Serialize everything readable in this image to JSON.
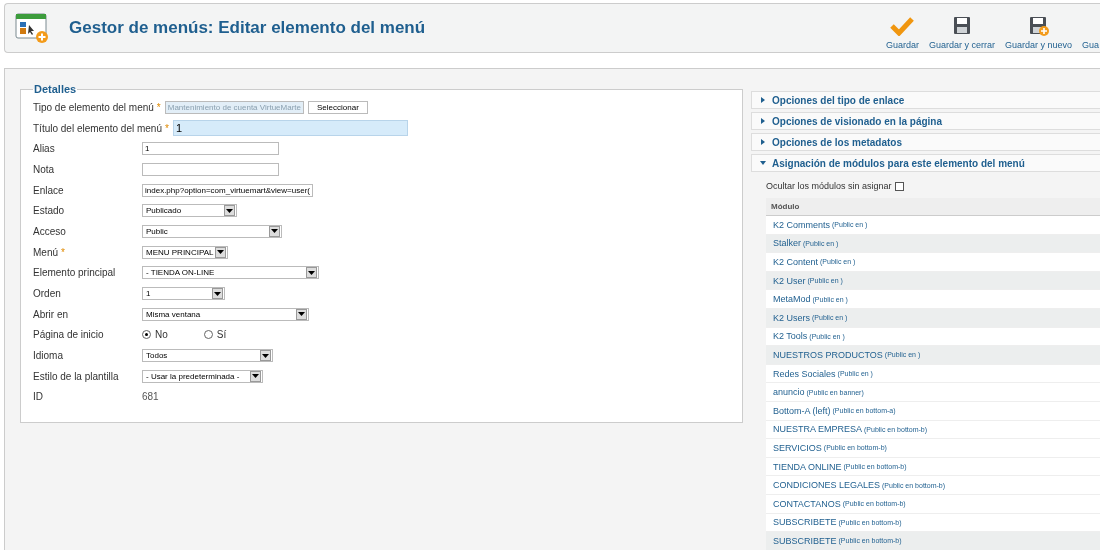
{
  "header": {
    "title": "Gestor de menús: Editar elemento del menú"
  },
  "toolbar": [
    {
      "label": "Guardar",
      "kind": "check"
    },
    {
      "label": "Guardar y cerrar",
      "kind": "save"
    },
    {
      "label": "Guardar y nuevo",
      "kind": "save-new"
    },
    {
      "label": "Gua",
      "kind": "cut"
    }
  ],
  "details": {
    "legend": "Detalles",
    "fields": [
      {
        "kind": "picker",
        "label": "Tipo de elemento del menú",
        "marker": "*",
        "value": "Mantenimiento de cuenta VirtueMarte",
        "button": "Seleccionar"
      },
      {
        "kind": "title",
        "label": "Título del elemento del menú",
        "marker": "*",
        "value": "1"
      },
      {
        "kind": "text",
        "label": "Alias",
        "value": "1"
      },
      {
        "kind": "text",
        "label": "Nota"
      },
      {
        "kind": "text",
        "label": "Enlace",
        "value": "index.php?option=com_virtuemart&view=user("
      },
      {
        "kind": "select",
        "label": "Estado",
        "value": "Publicado"
      },
      {
        "kind": "select",
        "label": "Acceso",
        "value": "Public"
      },
      {
        "kind": "select",
        "label": "Menú",
        "marker": "*",
        "value": "MENU PRINCIPAL"
      },
      {
        "kind": "select",
        "label": "Elemento principal",
        "value": "- TIENDA ON-LINE"
      },
      {
        "kind": "select",
        "label": "Orden",
        "value": "1"
      },
      {
        "kind": "select",
        "label": "Abrir en",
        "value": "Misma ventana"
      },
      {
        "kind": "radio",
        "label": "Página de inicio",
        "options": [
          {
            "label": "No",
            "selected": true
          },
          {
            "label": "Sí",
            "selected": false
          }
        ]
      },
      {
        "kind": "select",
        "label": "Idioma",
        "value": "Todos"
      },
      {
        "kind": "select",
        "label": "Estilo de la plantilla",
        "value": "- Usar la predeterminada -"
      },
      {
        "kind": "static",
        "label": "ID",
        "value": "681"
      }
    ]
  },
  "panels": [
    {
      "title": "Opciones del tipo de enlace",
      "expanded": false
    },
    {
      "title": "Opciones de visionado en la página",
      "expanded": false
    },
    {
      "title": "Opciones de los metadatos",
      "expanded": false
    },
    {
      "title": "Asignación de módulos para este elemento del menú",
      "expanded": true
    }
  ],
  "modules": {
    "hide_label": "Ocultar los módulos sin asignar",
    "hide_checked": false,
    "column": "Módulo",
    "rows": [
      {
        "name": "K2 Comments",
        "info": "(Public en )",
        "highlighted": false
      },
      {
        "name": "Stalker",
        "info": "(Public en )",
        "highlighted": true
      },
      {
        "name": "K2 Content",
        "info": "(Public en )",
        "highlighted": false
      },
      {
        "name": "K2 User",
        "info": "(Public en )",
        "highlighted": true
      },
      {
        "name": "MetaMod",
        "info": "(Public en )",
        "highlighted": false
      },
      {
        "name": "K2 Users",
        "info": "(Public en )",
        "highlighted": true
      },
      {
        "name": "K2 Tools",
        "info": "(Public en )",
        "highlighted": false
      },
      {
        "name": "NUESTROS PRODUCTOS",
        "info": "(Public en )",
        "highlighted": true
      },
      {
        "name": "Redes Sociales",
        "info": "(Public en )",
        "highlighted": false
      },
      {
        "name": "anuncio",
        "info": "(Public en banner)",
        "highlighted": false
      },
      {
        "name": "Bottom-A (left)",
        "info": "(Public en bottom-a)",
        "highlighted": false
      },
      {
        "name": "NUESTRA EMPRESA",
        "info": "(Public en bottom-b)",
        "highlighted": false
      },
      {
        "name": "SERVICIOS",
        "info": "(Public en bottom-b)",
        "highlighted": false
      },
      {
        "name": "TIENDA ONLINE",
        "info": "(Public en bottom-b)",
        "highlighted": false
      },
      {
        "name": "CONDICIONES LEGALES",
        "info": "(Public en bottom-b)",
        "highlighted": false
      },
      {
        "name": "CONTACTANOS",
        "info": "(Public en bottom-b)",
        "highlighted": false
      },
      {
        "name": "SUBSCRIBETE",
        "info": "(Public en bottom-b)",
        "highlighted": false
      },
      {
        "name": "SUBSCRIBETE",
        "info": "(Public en bottom-b)",
        "highlighted": true
      }
    ]
  }
}
